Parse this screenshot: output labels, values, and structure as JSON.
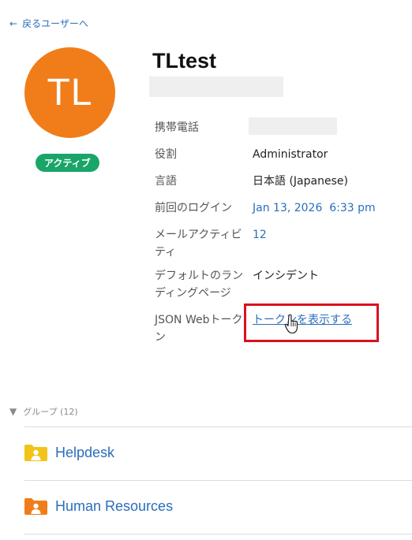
{
  "nav": {
    "back_label": "戻るユーザーへ"
  },
  "profile": {
    "initials": "TL",
    "name": "TLtest",
    "status": "アクティブ",
    "avatar_color": "#f07d1a",
    "status_color": "#1aa568"
  },
  "fields": {
    "phone_label": "携帯電話",
    "role_label": "役割",
    "role_value": "Administrator",
    "language_label": "言語",
    "language_value": "日本語 (Japanese)",
    "last_login_label": "前回のログイン",
    "last_login_value": "Jan 13, 2026  6:33 pm",
    "email_activity_label": "メールアクティビティ",
    "email_activity_value": "12",
    "landing_page_label": "デフォルトのランディングページ",
    "landing_page_value": "インシデント",
    "jwt_label": "JSON Webトークン",
    "jwt_link": "トークンを表示する"
  },
  "groups": {
    "header": "グループ (12)",
    "items": [
      {
        "name": "Helpdesk",
        "color": "#f2c318"
      },
      {
        "name": "Human Resources",
        "color": "#f07d1a"
      }
    ]
  },
  "colors": {
    "link": "#2a6ebb",
    "highlight": "#d9121f"
  }
}
